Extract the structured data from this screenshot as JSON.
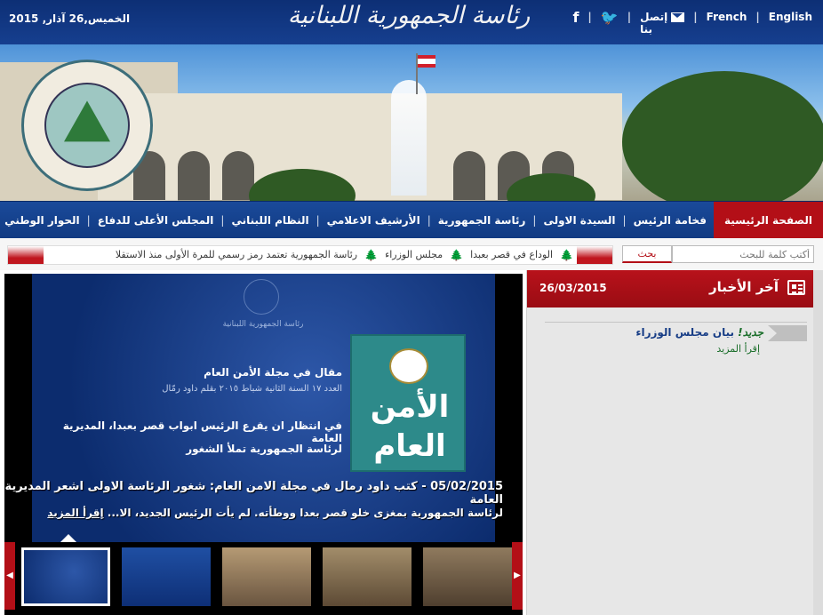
{
  "topbar": {
    "date": "الخميس,26 آذار, 2015",
    "logo_text": "رئاسة الجمهورية اللبنانية",
    "contact_label_1": "إتصل",
    "contact_label_2": "بنا",
    "lang_french": "French",
    "lang_english": "English",
    "social": [
      "facebook-icon",
      "twitter-icon",
      "mail-icon"
    ]
  },
  "nav": {
    "items": [
      "الصفحة الرئيسية",
      "فخامة الرئيس",
      "السيدة الاولى",
      "رئاسة الجمهورية",
      "الأرشيف الاعلامي",
      "النظام اللبناني",
      "المجلس الأعلى للدفاع",
      "الحوار الوطني"
    ],
    "active_index": 0
  },
  "search": {
    "placeholder": "أكتب كلمة للبحث",
    "button_label": "بحث"
  },
  "ticker": {
    "items": [
      "الوداع في قصر بعبدا",
      "مجلس الوزراء",
      "رئاسة الجمهورية تعتمد رمز رسمي للمرة الأولى منذ الاستقلا"
    ]
  },
  "slide": {
    "emblem_caption": "رئاسة الجمهورية اللبنانية",
    "heading": "مقال في مجلة الأمن العام",
    "subheading": "العدد ١٧ السنة الثانية شباط ٢٠١٥ بقلم داود رمّال",
    "body_line1": "في انتظار ان يقرع الرئيس ابواب قصر بعبدا، المديرية العامة",
    "body_line2": "لرئاسة الجمهورية تملأ الشغور",
    "cover_line1": "الأمن",
    "cover_line2": "العام",
    "caption_line1": "05/02/2015 - كتب داود رمال في مجلة الامن العام: شغور الرئاسة الاولى اشعر المديرية العامة",
    "caption_line2": "لرئاسة الجمهورية بمغزى خلو قصر بعدا ووطأته. لم يأت الرئيس الجديد، الا...",
    "read_more": "إقرأ المزيد"
  },
  "news": {
    "title": "آخر الأخبار",
    "date": "26/03/2015",
    "items": [
      {
        "new_label": "جديد!",
        "title": "بيان مجلس الوزراء",
        "more": "إقرأ المزيد"
      }
    ]
  },
  "colors": {
    "nav_blue": "#113a82",
    "accent_red": "#b30f17",
    "green": "#1a6e2a"
  }
}
